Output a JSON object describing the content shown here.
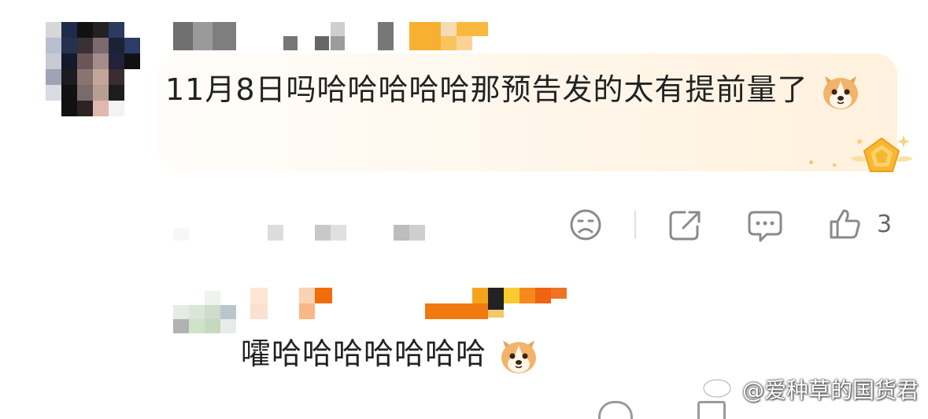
{
  "comment": {
    "text": "11月8日吗哈哈哈哈哈那预告发的太有提前量了",
    "emoji": "dog-face-icon",
    "badge": "gold-pentagon-badge-icon",
    "actions": {
      "dislike_icon": "frown-face-icon",
      "share_icon": "share-icon",
      "reply_icon": "comment-bubble-icon",
      "like_icon": "thumbs-up-icon",
      "like_count": "3"
    }
  },
  "reply": {
    "text": "嚯哈哈哈哈哈哈哈",
    "emoji": "dog-face-icon"
  },
  "watermark": {
    "text": "@爱种草的国货君",
    "logo": "weibo-icon"
  },
  "colors": {
    "accent_orange": "#f07a10",
    "badge_gold": "#f7b733",
    "card_bg": "#fff4e4",
    "icon_gray": "#8a8a8a"
  }
}
